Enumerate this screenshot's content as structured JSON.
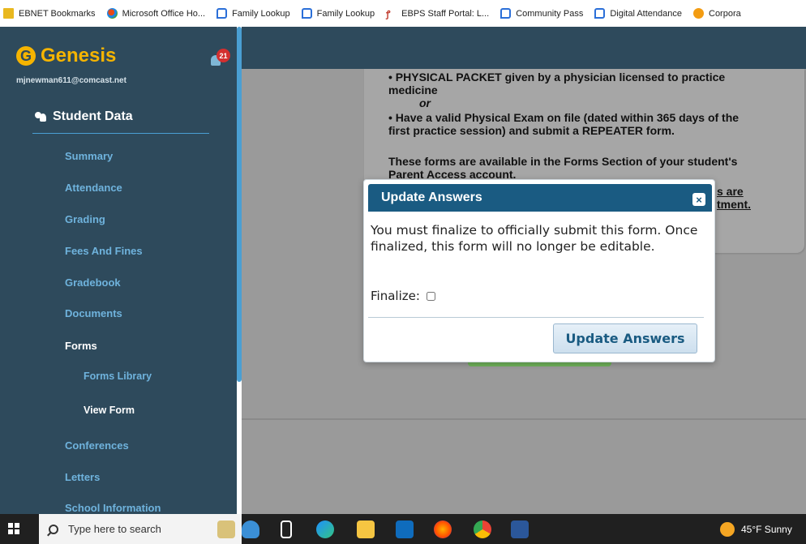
{
  "bookmarks": [
    {
      "icon": "folder-icon",
      "label": "EBNET Bookmarks"
    },
    {
      "icon": "office-icon",
      "label": "Microsoft Office Ho..."
    },
    {
      "icon": "chat-icon",
      "label": "Family Lookup"
    },
    {
      "icon": "chat-icon",
      "label": "Family Lookup"
    },
    {
      "icon": "ebps-icon",
      "label": "EBPS Staff Portal: L..."
    },
    {
      "icon": "chat-icon",
      "label": "Community Pass"
    },
    {
      "icon": "chat-icon",
      "label": "Digital Attendance"
    },
    {
      "icon": "corp-icon",
      "label": "Corpora"
    }
  ],
  "sidebar": {
    "logo_text": "Genesis",
    "notification_count": "21",
    "email": "mjnewman611@comcast.net",
    "section_title": "Student Data",
    "items": [
      {
        "label": "Summary"
      },
      {
        "label": "Attendance"
      },
      {
        "label": "Grading"
      },
      {
        "label": "Fees And Fines"
      },
      {
        "label": "Gradebook"
      },
      {
        "label": "Documents"
      },
      {
        "label": "Forms"
      },
      {
        "label": "Forms Library"
      },
      {
        "label": "View Form"
      },
      {
        "label": "Conferences"
      },
      {
        "label": "Letters"
      },
      {
        "label": "School Information"
      }
    ]
  },
  "content": {
    "line1": "• PHYSICAL PACKET given by a physician licensed to practice",
    "line2": "medicine",
    "or": "or",
    "line3": "• Have a valid Physical Exam on file (dated within 365 days of the",
    "line4": "first practice session) and submit a REPEATER form.",
    "line5": "These forms are available in the Forms Section of your student's",
    "line6": "Parent Access account.",
    "link_frag1": "s are",
    "link_frag2": "tment."
  },
  "modal": {
    "title": "Update Answers",
    "close_label": "×",
    "message": "You must finalize to officially submit this form. Once finalized, this form will no longer be editable.",
    "finalize_label": "Finalize:",
    "finalize_checked": false,
    "button_label": "Update Answers"
  },
  "taskbar": {
    "search_placeholder": "Type here to search",
    "weather": "45°F  Sunny"
  }
}
